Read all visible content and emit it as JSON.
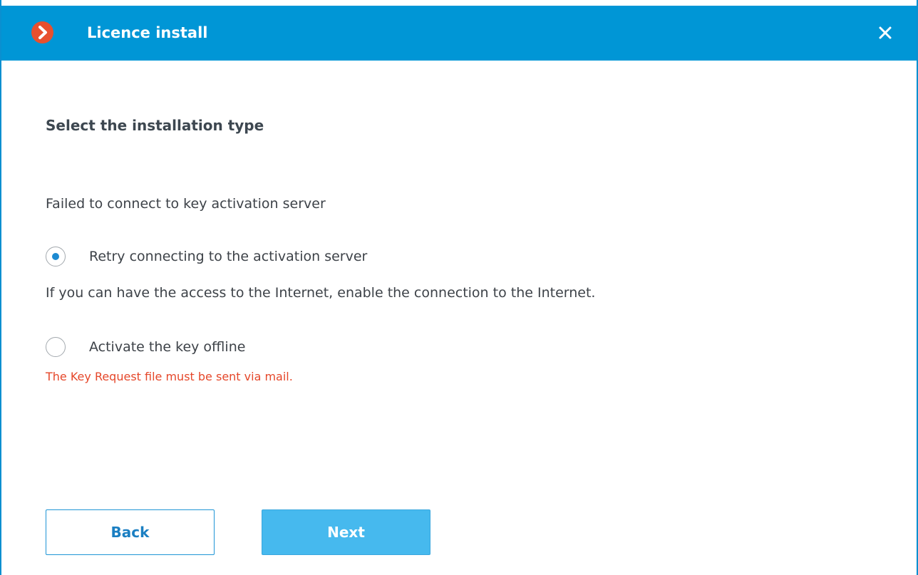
{
  "window": {
    "title": "Licence install",
    "logo_icon": "chevron-right-icon",
    "close_icon": "close-icon",
    "title_bar_color": "#0096d6",
    "logo_color": "#e8502e"
  },
  "content": {
    "heading": "Select the installation type",
    "message": "Failed to connect to key activation server",
    "options": [
      {
        "label": "Retry connecting to the activation server",
        "checked": true
      },
      {
        "label": "Activate the key offline",
        "checked": false
      }
    ],
    "hint": "If you can have the access to the Internet, enable the connection to the Internet.",
    "warning": "The Key Request file must be sent via mail.",
    "warning_color": "#e5472a"
  },
  "buttons": {
    "back_label": "Back",
    "next_label": "Next"
  }
}
